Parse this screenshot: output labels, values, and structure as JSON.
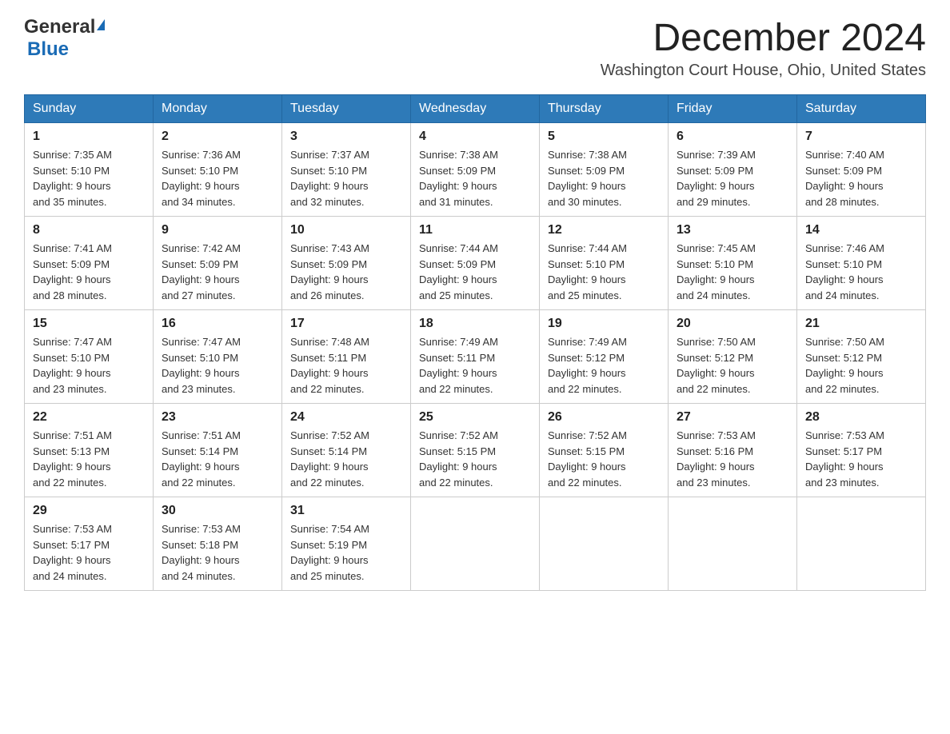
{
  "header": {
    "logo_general": "General",
    "logo_blue": "Blue",
    "month_title": "December 2024",
    "location": "Washington Court House, Ohio, United States"
  },
  "weekdays": [
    "Sunday",
    "Monday",
    "Tuesday",
    "Wednesday",
    "Thursday",
    "Friday",
    "Saturday"
  ],
  "weeks": [
    [
      {
        "day": "1",
        "sunrise": "7:35 AM",
        "sunset": "5:10 PM",
        "daylight": "9 hours and 35 minutes."
      },
      {
        "day": "2",
        "sunrise": "7:36 AM",
        "sunset": "5:10 PM",
        "daylight": "9 hours and 34 minutes."
      },
      {
        "day": "3",
        "sunrise": "7:37 AM",
        "sunset": "5:10 PM",
        "daylight": "9 hours and 32 minutes."
      },
      {
        "day": "4",
        "sunrise": "7:38 AM",
        "sunset": "5:09 PM",
        "daylight": "9 hours and 31 minutes."
      },
      {
        "day": "5",
        "sunrise": "7:38 AM",
        "sunset": "5:09 PM",
        "daylight": "9 hours and 30 minutes."
      },
      {
        "day": "6",
        "sunrise": "7:39 AM",
        "sunset": "5:09 PM",
        "daylight": "9 hours and 29 minutes."
      },
      {
        "day": "7",
        "sunrise": "7:40 AM",
        "sunset": "5:09 PM",
        "daylight": "9 hours and 28 minutes."
      }
    ],
    [
      {
        "day": "8",
        "sunrise": "7:41 AM",
        "sunset": "5:09 PM",
        "daylight": "9 hours and 28 minutes."
      },
      {
        "day": "9",
        "sunrise": "7:42 AM",
        "sunset": "5:09 PM",
        "daylight": "9 hours and 27 minutes."
      },
      {
        "day": "10",
        "sunrise": "7:43 AM",
        "sunset": "5:09 PM",
        "daylight": "9 hours and 26 minutes."
      },
      {
        "day": "11",
        "sunrise": "7:44 AM",
        "sunset": "5:09 PM",
        "daylight": "9 hours and 25 minutes."
      },
      {
        "day": "12",
        "sunrise": "7:44 AM",
        "sunset": "5:10 PM",
        "daylight": "9 hours and 25 minutes."
      },
      {
        "day": "13",
        "sunrise": "7:45 AM",
        "sunset": "5:10 PM",
        "daylight": "9 hours and 24 minutes."
      },
      {
        "day": "14",
        "sunrise": "7:46 AM",
        "sunset": "5:10 PM",
        "daylight": "9 hours and 24 minutes."
      }
    ],
    [
      {
        "day": "15",
        "sunrise": "7:47 AM",
        "sunset": "5:10 PM",
        "daylight": "9 hours and 23 minutes."
      },
      {
        "day": "16",
        "sunrise": "7:47 AM",
        "sunset": "5:10 PM",
        "daylight": "9 hours and 23 minutes."
      },
      {
        "day": "17",
        "sunrise": "7:48 AM",
        "sunset": "5:11 PM",
        "daylight": "9 hours and 22 minutes."
      },
      {
        "day": "18",
        "sunrise": "7:49 AM",
        "sunset": "5:11 PM",
        "daylight": "9 hours and 22 minutes."
      },
      {
        "day": "19",
        "sunrise": "7:49 AM",
        "sunset": "5:12 PM",
        "daylight": "9 hours and 22 minutes."
      },
      {
        "day": "20",
        "sunrise": "7:50 AM",
        "sunset": "5:12 PM",
        "daylight": "9 hours and 22 minutes."
      },
      {
        "day": "21",
        "sunrise": "7:50 AM",
        "sunset": "5:12 PM",
        "daylight": "9 hours and 22 minutes."
      }
    ],
    [
      {
        "day": "22",
        "sunrise": "7:51 AM",
        "sunset": "5:13 PM",
        "daylight": "9 hours and 22 minutes."
      },
      {
        "day": "23",
        "sunrise": "7:51 AM",
        "sunset": "5:14 PM",
        "daylight": "9 hours and 22 minutes."
      },
      {
        "day": "24",
        "sunrise": "7:52 AM",
        "sunset": "5:14 PM",
        "daylight": "9 hours and 22 minutes."
      },
      {
        "day": "25",
        "sunrise": "7:52 AM",
        "sunset": "5:15 PM",
        "daylight": "9 hours and 22 minutes."
      },
      {
        "day": "26",
        "sunrise": "7:52 AM",
        "sunset": "5:15 PM",
        "daylight": "9 hours and 22 minutes."
      },
      {
        "day": "27",
        "sunrise": "7:53 AM",
        "sunset": "5:16 PM",
        "daylight": "9 hours and 23 minutes."
      },
      {
        "day": "28",
        "sunrise": "7:53 AM",
        "sunset": "5:17 PM",
        "daylight": "9 hours and 23 minutes."
      }
    ],
    [
      {
        "day": "29",
        "sunrise": "7:53 AM",
        "sunset": "5:17 PM",
        "daylight": "9 hours and 24 minutes."
      },
      {
        "day": "30",
        "sunrise": "7:53 AM",
        "sunset": "5:18 PM",
        "daylight": "9 hours and 24 minutes."
      },
      {
        "day": "31",
        "sunrise": "7:54 AM",
        "sunset": "5:19 PM",
        "daylight": "9 hours and 25 minutes."
      },
      null,
      null,
      null,
      null
    ]
  ],
  "labels": {
    "sunrise": "Sunrise:",
    "sunset": "Sunset:",
    "daylight": "Daylight:"
  }
}
